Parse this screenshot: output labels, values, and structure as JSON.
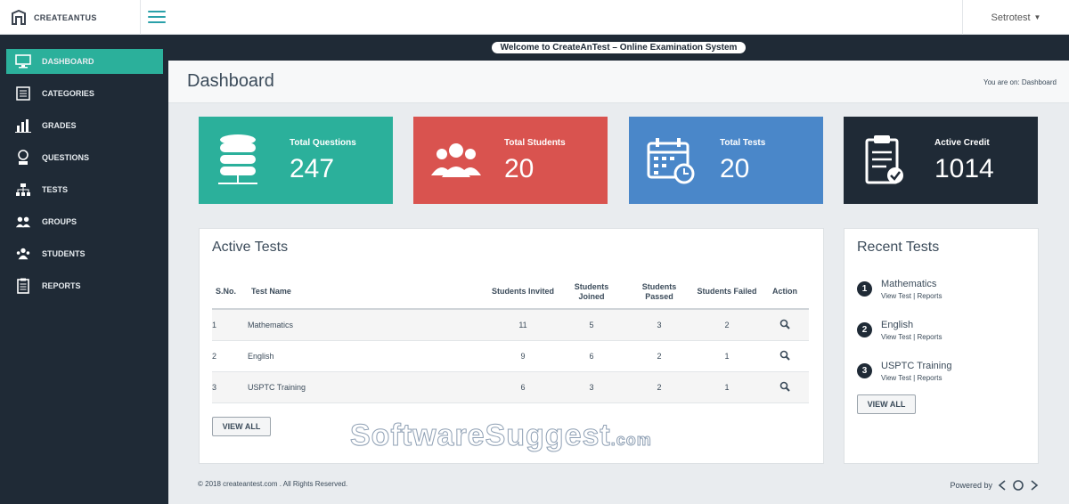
{
  "app": {
    "brand": "CREATEANTUS",
    "user_name": "Setrotest"
  },
  "notice": {
    "text": "Welcome to CreateAnTest – Online Examination System"
  },
  "sidebar": {
    "items": [
      {
        "label": "DASHBOARD",
        "icon": "monitor-icon",
        "active": true
      },
      {
        "label": "CATEGORIES",
        "icon": "list-icon"
      },
      {
        "label": "GRADES",
        "icon": "bar-chart-icon"
      },
      {
        "label": "QUESTIONS",
        "icon": "question-icon"
      },
      {
        "label": "TESTS",
        "icon": "sitemap-icon"
      },
      {
        "label": "GROUPS",
        "icon": "users-icon"
      },
      {
        "label": "STUDENTS",
        "icon": "student-icon"
      },
      {
        "label": "REPORTS",
        "icon": "clipboard-icon"
      }
    ]
  },
  "page": {
    "title": "Dashboard",
    "breadcrumb": "You are on: Dashboard"
  },
  "cards": [
    {
      "label": "Total Questions",
      "value": "247",
      "color": "#2bb09b",
      "icon": "database-icon"
    },
    {
      "label": "Total Students",
      "value": "20",
      "color": "#d9534f",
      "icon": "group-icon"
    },
    {
      "label": "Total Tests",
      "value": "20",
      "color": "#4a87c9",
      "icon": "calendar-icon"
    },
    {
      "label": "Active Credit",
      "value": "1014",
      "color": "#1f2a36",
      "icon": "clipboard-check-icon"
    }
  ],
  "active_tests": {
    "title": "Active Tests",
    "columns": [
      "S.No.",
      "Test Name",
      "Students Invited",
      "Students Joined",
      "Students Passed",
      "Students Failed",
      "Action"
    ],
    "rows": [
      {
        "sno": "1",
        "name": "Mathematics",
        "invited": "11",
        "joined": "5",
        "passed": "3",
        "failed": "2"
      },
      {
        "sno": "2",
        "name": "English",
        "invited": "9",
        "joined": "6",
        "passed": "2",
        "failed": "1"
      },
      {
        "sno": "3",
        "name": "USPTC Training",
        "invited": "6",
        "joined": "3",
        "passed": "2",
        "failed": "1"
      }
    ],
    "view_all": "VIEW ALL"
  },
  "recent_tests": {
    "title": "Recent Tests",
    "items": [
      {
        "num": "1",
        "name": "Mathematics",
        "view": "View Test",
        "reports": "Reports"
      },
      {
        "num": "2",
        "name": "English",
        "view": "View Test",
        "reports": "Reports"
      },
      {
        "num": "3",
        "name": "USPTC Training",
        "view": "View Test",
        "reports": "Reports"
      }
    ],
    "view_all": "VIEW ALL"
  },
  "footer": {
    "copyright": "© 2018 createantest.com . All Rights Reserved.",
    "powered_by": "Powered by"
  },
  "watermark": {
    "main": "SoftwareSuggest",
    "suffix": ".com"
  }
}
